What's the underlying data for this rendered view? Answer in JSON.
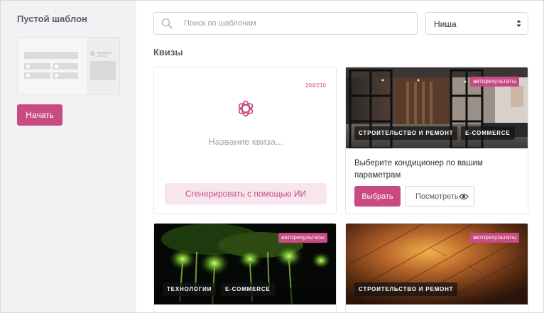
{
  "sidebar": {
    "title": "Пустой шаблон",
    "start_label": "Начать"
  },
  "search": {
    "placeholder": "Поиск по шаблонам",
    "value": ""
  },
  "niche": {
    "selected": "Ниша"
  },
  "section": {
    "title": "Квизы"
  },
  "generator": {
    "counter": "204/210",
    "placeholder": "Название квиза...",
    "button_label": "Сгенерировать с помощью ИИ"
  },
  "cards": [
    {
      "badge": "авторезультаты",
      "tags": [
        "СТРОИТЕЛЬСТВО И РЕМОНТ",
        "E-COMMERCE"
      ],
      "title": "Выберите кондиционер по вашим параметрам",
      "choose_label": "Выбрать",
      "view_label": "Посмотреть"
    },
    {
      "badge": "авторезультаты",
      "tags": [
        "ТЕХНОЛОГИИ",
        "E-COMMERCE"
      ]
    },
    {
      "badge": "авторезультаты",
      "tags": [
        "СТРОИТЕЛЬСТВО И РЕМОНТ"
      ]
    }
  ],
  "colors": {
    "accent": "#c74a82",
    "accent_light": "#f8e6ef",
    "sidebar_bg": "#f2f2f4"
  },
  "icons": {
    "search": "search-icon",
    "select": "chevron-updown-icon",
    "ai": "openai-icon",
    "view": "eye-icon"
  }
}
